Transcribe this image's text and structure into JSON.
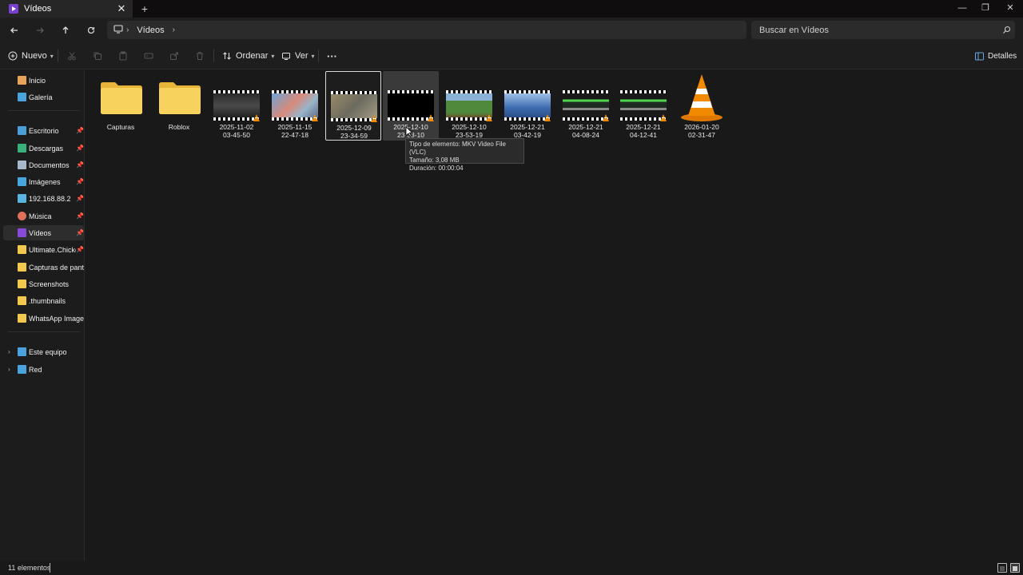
{
  "window": {
    "tab_title": "Vídeos",
    "minimize": "—",
    "maximize": "❐",
    "close": "✕"
  },
  "address": {
    "segments": [
      "Vídeos"
    ],
    "search_placeholder": "Buscar en Vídeos"
  },
  "toolbar": {
    "new_label": "Nuevo",
    "sort_label": "Ordenar",
    "view_label": "Ver",
    "more_label": "···",
    "details_label": "Detalles"
  },
  "sidebar": {
    "items": [
      {
        "label": "Inicio",
        "icon": "home-icon",
        "color": "#e8a35a"
      },
      {
        "label": "Galería",
        "icon": "gallery-icon",
        "color": "#4aa3df"
      },
      {
        "label": "Escritorio",
        "icon": "desktop-icon",
        "color": "#4a9fd8",
        "pinned": true
      },
      {
        "label": "Descargas",
        "icon": "download-icon",
        "color": "#38b07a",
        "pinned": true
      },
      {
        "label": "Documentos",
        "icon": "documents-icon",
        "color": "#a7b7cc",
        "pinned": true
      },
      {
        "label": "Imágenes",
        "icon": "pictures-icon",
        "color": "#46a6e0",
        "pinned": true
      },
      {
        "label": "192.168.88.2",
        "icon": "network-drive-icon",
        "color": "#5ab4e0",
        "pinned": true
      },
      {
        "label": "Música",
        "icon": "music-icon",
        "color": "#e0705a",
        "pinned": true
      },
      {
        "label": "Vídeos",
        "icon": "videos-icon",
        "color": "#8a4ad9",
        "pinned": true,
        "selected": true
      },
      {
        "label": "Ultimate.Chicke",
        "icon": "folder-icon",
        "color": "#f2c94c",
        "pinned": true
      },
      {
        "label": "Capturas de pantall",
        "icon": "folder-icon",
        "color": "#f2c94c"
      },
      {
        "label": "Screenshots",
        "icon": "folder-icon",
        "color": "#f2c94c"
      },
      {
        "label": ".thumbnails",
        "icon": "folder-icon",
        "color": "#f2c94c"
      },
      {
        "label": "WhatsApp Images",
        "icon": "folder-icon",
        "color": "#f2c94c"
      },
      {
        "label": "Este equipo",
        "icon": "pc-icon",
        "color": "#4aa3df",
        "expandable": true
      },
      {
        "label": "Red",
        "icon": "network-icon",
        "color": "#4aa3df",
        "expandable": true
      }
    ]
  },
  "files": [
    {
      "name": "Capturas",
      "kind": "folder"
    },
    {
      "name": "Roblox",
      "kind": "folder"
    },
    {
      "name": "2025-11-02 03-45-50",
      "line1": "2025-11-02",
      "line2": "03-45-50",
      "kind": "video",
      "thumb_color": "#3b3b3b"
    },
    {
      "name": "2025-11-15 22-47-18",
      "line1": "2025-11-15",
      "line2": "22-47-18",
      "kind": "video",
      "thumb_color": "#7aa6c9"
    },
    {
      "name": "2025-12-09 23-34-59",
      "line1": "2025-12-09",
      "line2": "23-34-59",
      "kind": "video",
      "thumb_color": "#8a7a5a",
      "selected": true
    },
    {
      "name": "2025-12-10 23-33-10",
      "line1": "2025-12-10",
      "line2": "23-33-10",
      "kind": "video",
      "thumb_color": "#000000",
      "hover": true
    },
    {
      "name": "2025-12-10 23-53-19",
      "line1": "2025-12-10",
      "line2": "23-53-19",
      "kind": "video",
      "thumb_color": "#4f8a3c"
    },
    {
      "name": "2025-12-21 03-42-19",
      "line1": "2025-12-21",
      "line2": "03-42-19",
      "kind": "video",
      "thumb_color": "#4a76b5"
    },
    {
      "name": "2025-12-21 04-08-24",
      "line1": "2025-12-21",
      "line2": "04-08-24",
      "kind": "video",
      "thumb_color": "#1f2a22"
    },
    {
      "name": "2025-12-21 04-12-41",
      "line1": "2025-12-21",
      "line2": "04-12-41",
      "kind": "video",
      "thumb_color": "#1f2a22"
    },
    {
      "name": "2026-01-20 02-31-47",
      "line1": "2026-01-20",
      "line2": "02-31-47",
      "kind": "vlc"
    }
  ],
  "tooltip": {
    "type": "Tipo de elemento: MKV Video File (VLC)",
    "size": "Tamaño: 3,08 MB",
    "duration": "Duración: 00:00:04"
  },
  "status": {
    "count": "11 elementos"
  },
  "colors": {
    "accent": "#8a4ad9",
    "folder": "#f2c94c",
    "vlc_orange": "#f28a00"
  }
}
